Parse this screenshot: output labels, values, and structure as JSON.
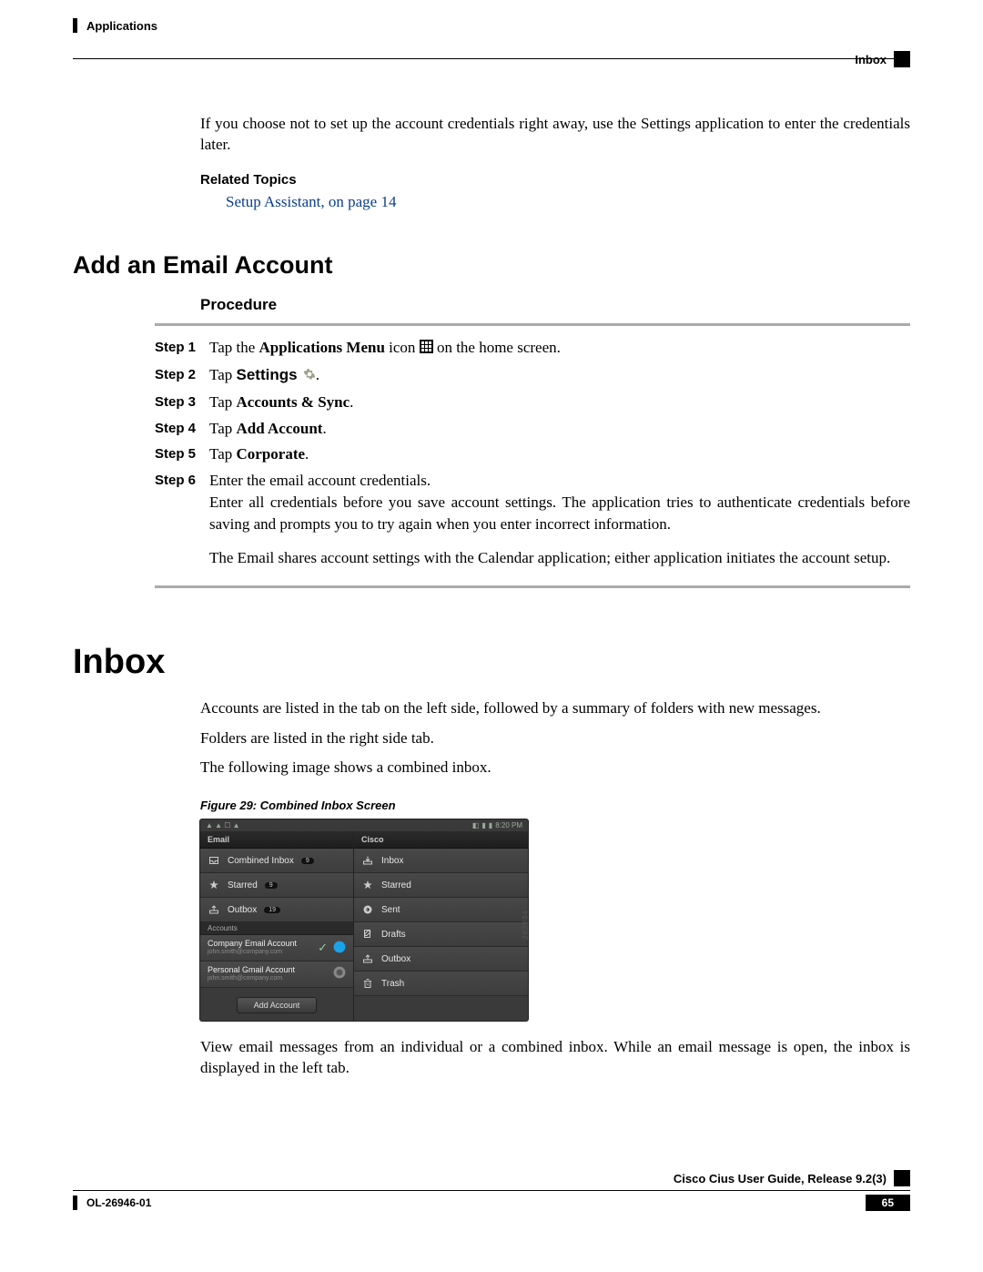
{
  "header": {
    "chapter": "Applications",
    "section": "Inbox"
  },
  "intro": {
    "para": "If you choose not to set up the account credentials right away, use the Settings application to enter the credentials later.",
    "related_topics_h": "Related Topics",
    "related_link": "Setup Assistant,  on page 14"
  },
  "add_email": {
    "heading": "Add an Email Account",
    "procedure_h": "Procedure",
    "steps": [
      {
        "label": "Step 1",
        "pre": "Tap the ",
        "bold": "Applications Menu",
        "post_icon": true,
        "tail": " on the home screen."
      },
      {
        "label": "Step 2",
        "pre": "Tap ",
        "bold_sans": "Settings",
        "gear_icon": true,
        "tail": "."
      },
      {
        "label": "Step 3",
        "pre": "Tap ",
        "bold": "Accounts & Sync",
        "tail": "."
      },
      {
        "label": "Step 4",
        "pre": "Tap ",
        "bold": "Add Account",
        "tail": "."
      },
      {
        "label": "Step 5",
        "pre": "Tap ",
        "bold": "Corporate",
        "tail": "."
      },
      {
        "label": "Step 6",
        "text": "Enter the email account credentials."
      }
    ],
    "step6_extra": "Enter all credentials before you save account settings. The application tries to authenticate credentials before saving and prompts you to try again when you enter incorrect information.",
    "note": "The Email shares account settings with the Calendar application; either application initiates the account setup."
  },
  "inbox": {
    "heading": "Inbox",
    "p1": "Accounts are listed in the tab on the left side, followed by a summary of folders with new messages.",
    "p2": "Folders are listed in the right side tab.",
    "p3": "The following image shows a combined inbox.",
    "fig_caption": "Figure 29: Combined Inbox Screen",
    "p4": "View email messages from an individual or a combined inbox. While an email message is open, the inbox is displayed in the left tab."
  },
  "screenshot": {
    "time": "8:20 PM",
    "left_header": "Email",
    "right_header": "Cisco",
    "left_items": [
      {
        "icon": "inbox",
        "label": "Combined Inbox",
        "badge": "9"
      },
      {
        "icon": "star",
        "label": "Starred",
        "badge": "9"
      },
      {
        "icon": "outbox",
        "label": "Outbox",
        "badge": "19"
      }
    ],
    "accounts_h": "Accounts",
    "accounts": [
      {
        "name": "Company Email Account",
        "email": "john.smith@company.com",
        "check": true,
        "circle": "blue"
      },
      {
        "name": "Personal Gmail Account",
        "email": "john.smith@company.com",
        "circle": "gray"
      }
    ],
    "add_account": "Add Account",
    "right_items": [
      {
        "icon": "inbox-dl",
        "label": "Inbox"
      },
      {
        "icon": "star",
        "label": "Starred"
      },
      {
        "icon": "sent",
        "label": "Sent"
      },
      {
        "icon": "drafts",
        "label": "Drafts"
      },
      {
        "icon": "outbox",
        "label": "Outbox"
      },
      {
        "icon": "trash",
        "label": "Trash"
      }
    ],
    "side_num": "282884"
  },
  "footer": {
    "title": "Cisco Cius User Guide, Release 9.2(3)",
    "doc_id": "OL-26946-01",
    "page": "65"
  }
}
